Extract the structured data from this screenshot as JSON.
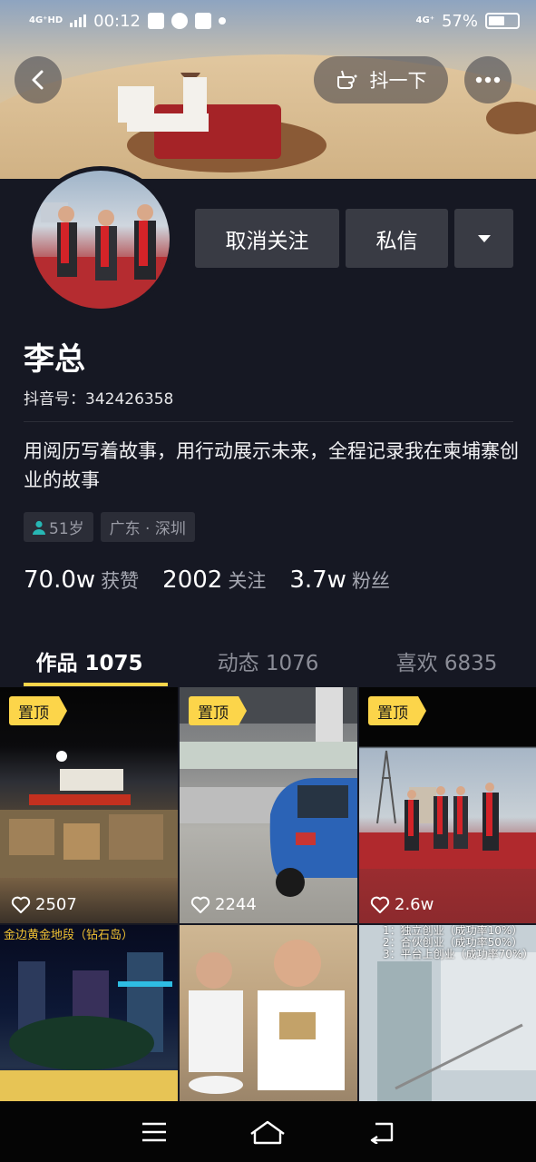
{
  "status_bar": {
    "network": "4G⁺HD",
    "time": "00:12",
    "network_right": "4G⁺",
    "battery": "57%"
  },
  "header": {
    "back_icon": "chevron-left-icon",
    "shake_label": "抖一下",
    "more_icon": "more-dots-icon"
  },
  "profile": {
    "unfollow_label": "取消关注",
    "message_label": "私信",
    "dropdown_icon": "caret-down-icon",
    "name": "李总",
    "douyin_id": "抖音号：342426358",
    "bio": "用阅历写着故事，用行动展示未来，全程记录我在柬埔寨创业的故事",
    "tags": [
      {
        "icon": "person-icon",
        "label": "51岁"
      },
      {
        "icon": "",
        "label": "广东 · 深圳"
      }
    ],
    "stats": [
      {
        "num": "70.0w",
        "label": "获赞"
      },
      {
        "num": "2002",
        "label": "关注"
      },
      {
        "num": "3.7w",
        "label": "粉丝"
      }
    ]
  },
  "tabs": [
    {
      "label": "作品 1075",
      "active": true
    },
    {
      "label": "动态 1076",
      "active": false
    },
    {
      "label": "喜欢 6835",
      "active": false
    }
  ],
  "videos": [
    {
      "pinned": "置顶",
      "likes": "2507",
      "caption": ""
    },
    {
      "pinned": "置顶",
      "likes": "2244",
      "caption": ""
    },
    {
      "pinned": "置顶",
      "likes": "2.6w",
      "caption": ""
    },
    {
      "pinned": "",
      "likes": "",
      "caption": "金边黄金地段（钻石岛）"
    },
    {
      "pinned": "",
      "likes": "",
      "caption": ""
    },
    {
      "pinned": "",
      "likes": "",
      "caption": "1：独立创业（成功率10%）\n2：合伙创业（成功率50%）\n3：平台上创业（成功率70%）"
    }
  ],
  "colors": {
    "background": "#161823",
    "button": "#393b44",
    "accent": "#fcd54a"
  }
}
